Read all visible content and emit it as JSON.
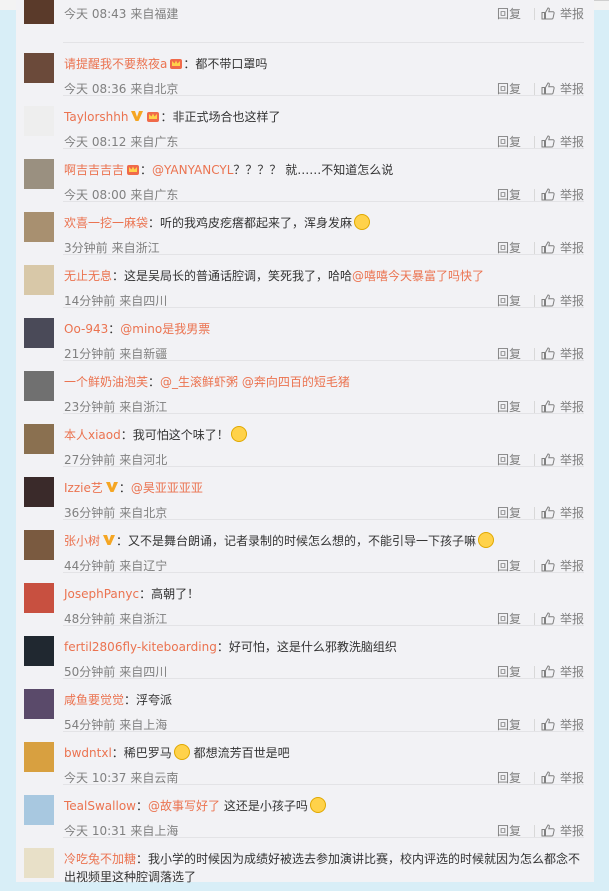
{
  "comments": [
    {
      "user": "",
      "time": "今天 08:43",
      "location": "来自福建",
      "parts": [],
      "badges": [],
      "avatar": "#5a3a2a"
    },
    {
      "user": "请提醒我不要熬夜a",
      "badges": [
        "crown"
      ],
      "time": "今天 08:36",
      "location": "来自北京",
      "parts": [
        {
          "t": "text",
          "v": "：都不带口罩吗"
        }
      ],
      "avatar": "#6b4a3a"
    },
    {
      "user": "Taylorshhh",
      "badges": [
        "v",
        "crown"
      ],
      "time": "今天 08:12",
      "location": "来自广东",
      "parts": [
        {
          "t": "text",
          "v": "：非正式场合也这样了"
        }
      ],
      "avatar": "#eeeeee"
    },
    {
      "user": "啊吉吉吉吉",
      "badges": [
        "crown"
      ],
      "time": "今天 08:00",
      "location": "来自广东",
      "parts": [
        {
          "t": "text",
          "v": "："
        },
        {
          "t": "mention",
          "v": "@YANYANCYL"
        },
        {
          "t": "text",
          "v": "？？？？ 就……不知道怎么说"
        }
      ],
      "avatar": "#9a9080"
    },
    {
      "user": "欢喜一挖一麻袋",
      "badges": [],
      "time": "3分钟前",
      "location": "来自浙江",
      "parts": [
        {
          "t": "text",
          "v": "：听的我鸡皮疙瘩都起来了，浑身发麻"
        },
        {
          "t": "emoji"
        }
      ],
      "avatar": "#a89070"
    },
    {
      "user": "无止无息",
      "badges": [],
      "time": "14分钟前",
      "location": "来自四川",
      "parts": [
        {
          "t": "text",
          "v": "：这是吴局长的普通话腔调，笑死我了，哈哈"
        },
        {
          "t": "mention",
          "v": "@嘻嘻今天暴富了吗快了"
        }
      ],
      "avatar": "#d8c8a8"
    },
    {
      "user": "Oo-943",
      "badges": [],
      "time": "21分钟前",
      "location": "来自新疆",
      "parts": [
        {
          "t": "text",
          "v": "："
        },
        {
          "t": "mention",
          "v": "@mino是我男票"
        }
      ],
      "avatar": "#4a4a58"
    },
    {
      "user": "一个鲜奶油泡芙",
      "badges": [],
      "time": "23分钟前",
      "location": "来自浙江",
      "parts": [
        {
          "t": "text",
          "v": "："
        },
        {
          "t": "mention",
          "v": "@_生滚鲜虾粥"
        },
        {
          "t": "text",
          "v": " "
        },
        {
          "t": "mention",
          "v": "@奔向四百的短毛猪"
        }
      ],
      "avatar": "#707070"
    },
    {
      "user": "本人xiaod",
      "badges": [],
      "time": "27分钟前",
      "location": "来自河北",
      "parts": [
        {
          "t": "text",
          "v": "：我可怕这个味了！"
        },
        {
          "t": "emoji"
        }
      ],
      "avatar": "#8a7050"
    },
    {
      "user": "Izzie艺",
      "badges": [
        "v"
      ],
      "time": "36分钟前",
      "location": "来自北京",
      "parts": [
        {
          "t": "text",
          "v": "："
        },
        {
          "t": "mention",
          "v": "@昊亚亚亚亚"
        }
      ],
      "avatar": "#3a2a2a"
    },
    {
      "user": "张小树",
      "badges": [
        "v"
      ],
      "time": "44分钟前",
      "location": "来自辽宁",
      "parts": [
        {
          "t": "text",
          "v": "：又不是舞台朗诵，记者录制的时候怎么想的，不能引导一下孩子嘛"
        },
        {
          "t": "emoji"
        }
      ],
      "avatar": "#7a5a40"
    },
    {
      "user": "JosephPanyc",
      "badges": [],
      "time": "48分钟前",
      "location": "来自浙江",
      "parts": [
        {
          "t": "text",
          "v": "：高朝了！"
        }
      ],
      "avatar": "#c85040"
    },
    {
      "user": "fertil2806fly-kiteboarding",
      "badges": [],
      "time": "50分钟前",
      "location": "来自四川",
      "parts": [
        {
          "t": "text",
          "v": "：好可怕，这是什么邪教洗脑组织"
        }
      ],
      "avatar": "#202830"
    },
    {
      "user": "咸鱼要觉觉",
      "badges": [],
      "time": "54分钟前",
      "location": "来自上海",
      "parts": [
        {
          "t": "text",
          "v": "：浮夸派"
        }
      ],
      "avatar": "#5a4a6a"
    },
    {
      "user": "bwdntxl",
      "badges": [],
      "time": "今天 10:37",
      "location": "来自云南",
      "parts": [
        {
          "t": "text",
          "v": "：稀巴罗马"
        },
        {
          "t": "emoji"
        },
        {
          "t": "text",
          "v": " 都想流芳百世是吧"
        }
      ],
      "avatar": "#d8a040"
    },
    {
      "user": "TealSwallow",
      "badges": [],
      "time": "今天 10:31",
      "location": "来自上海",
      "parts": [
        {
          "t": "text",
          "v": "："
        },
        {
          "t": "mention",
          "v": "@故事写好了"
        },
        {
          "t": "text",
          "v": " 这还是小孩子吗"
        },
        {
          "t": "emoji"
        }
      ],
      "avatar": "#a8c8e0"
    },
    {
      "user": "冷吃兔不加糖",
      "badges": [],
      "time": "",
      "location": "",
      "parts": [
        {
          "t": "text",
          "v": "：我小学的时候因为成绩好被选去参加演讲比赛，校内评选的时候就因为怎么都念不出视频里这种腔调落选了"
        }
      ],
      "avatar": "#e8e0c8",
      "wrap": true
    }
  ],
  "reply_label": "回复",
  "report_label": "举报"
}
